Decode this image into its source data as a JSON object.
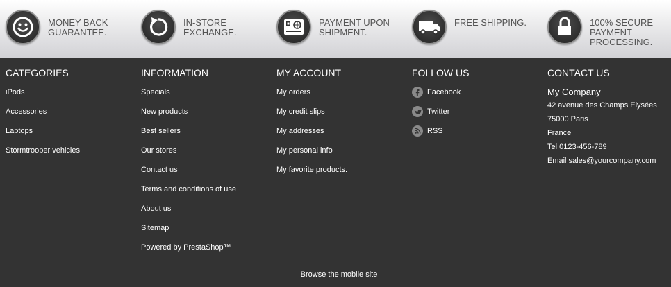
{
  "reassurance": [
    {
      "icon": "smiley-icon",
      "line1": "MONEY BACK",
      "line2": "GUARANTEE.",
      "line3": ""
    },
    {
      "icon": "refresh-arrow-icon",
      "line1": "IN-STORE",
      "line2": "EXCHANGE.",
      "line3": ""
    },
    {
      "icon": "payment-card-icon",
      "line1": "PAYMENT UPON",
      "line2": "SHIPMENT.",
      "line3": ""
    },
    {
      "icon": "delivery-truck-icon",
      "line1": "FREE SHIPPING.",
      "line2": "",
      "line3": ""
    },
    {
      "icon": "padlock-icon",
      "line1": "100% SECURE",
      "line2": "PAYMENT",
      "line3": "PROCESSING."
    }
  ],
  "categories": {
    "title": "CATEGORIES",
    "items": [
      "iPods",
      "Accessories",
      "Laptops",
      "Stormtrooper vehicles"
    ]
  },
  "information": {
    "title": "INFORMATION",
    "items": [
      "Specials",
      "New products",
      "Best sellers",
      "Our stores",
      "Contact us",
      "Terms and conditions of use",
      "About us",
      "Sitemap",
      "Powered by PrestaShop™"
    ]
  },
  "account": {
    "title": "MY ACCOUNT",
    "items": [
      "My orders",
      "My credit slips",
      "My addresses",
      "My personal info",
      "My favorite products."
    ]
  },
  "follow": {
    "title": "FOLLOW US",
    "items": [
      {
        "label": "Facebook",
        "icon": "facebook-icon"
      },
      {
        "label": "Twitter",
        "icon": "twitter-icon"
      },
      {
        "label": "RSS",
        "icon": "rss-icon"
      }
    ]
  },
  "contact": {
    "title": "CONTACT US",
    "company": "My Company",
    "address1": "42 avenue des Champs Elysées",
    "address2": "75000 Paris",
    "country": "France",
    "phone": "Tel 0123-456-789",
    "email": "Email sales@yourcompany.com"
  },
  "mobile_link": "Browse the mobile site",
  "colors": {
    "footer_bg": "#333333",
    "strip_text": "#555555",
    "icon_bg": "#2e2e2e"
  }
}
